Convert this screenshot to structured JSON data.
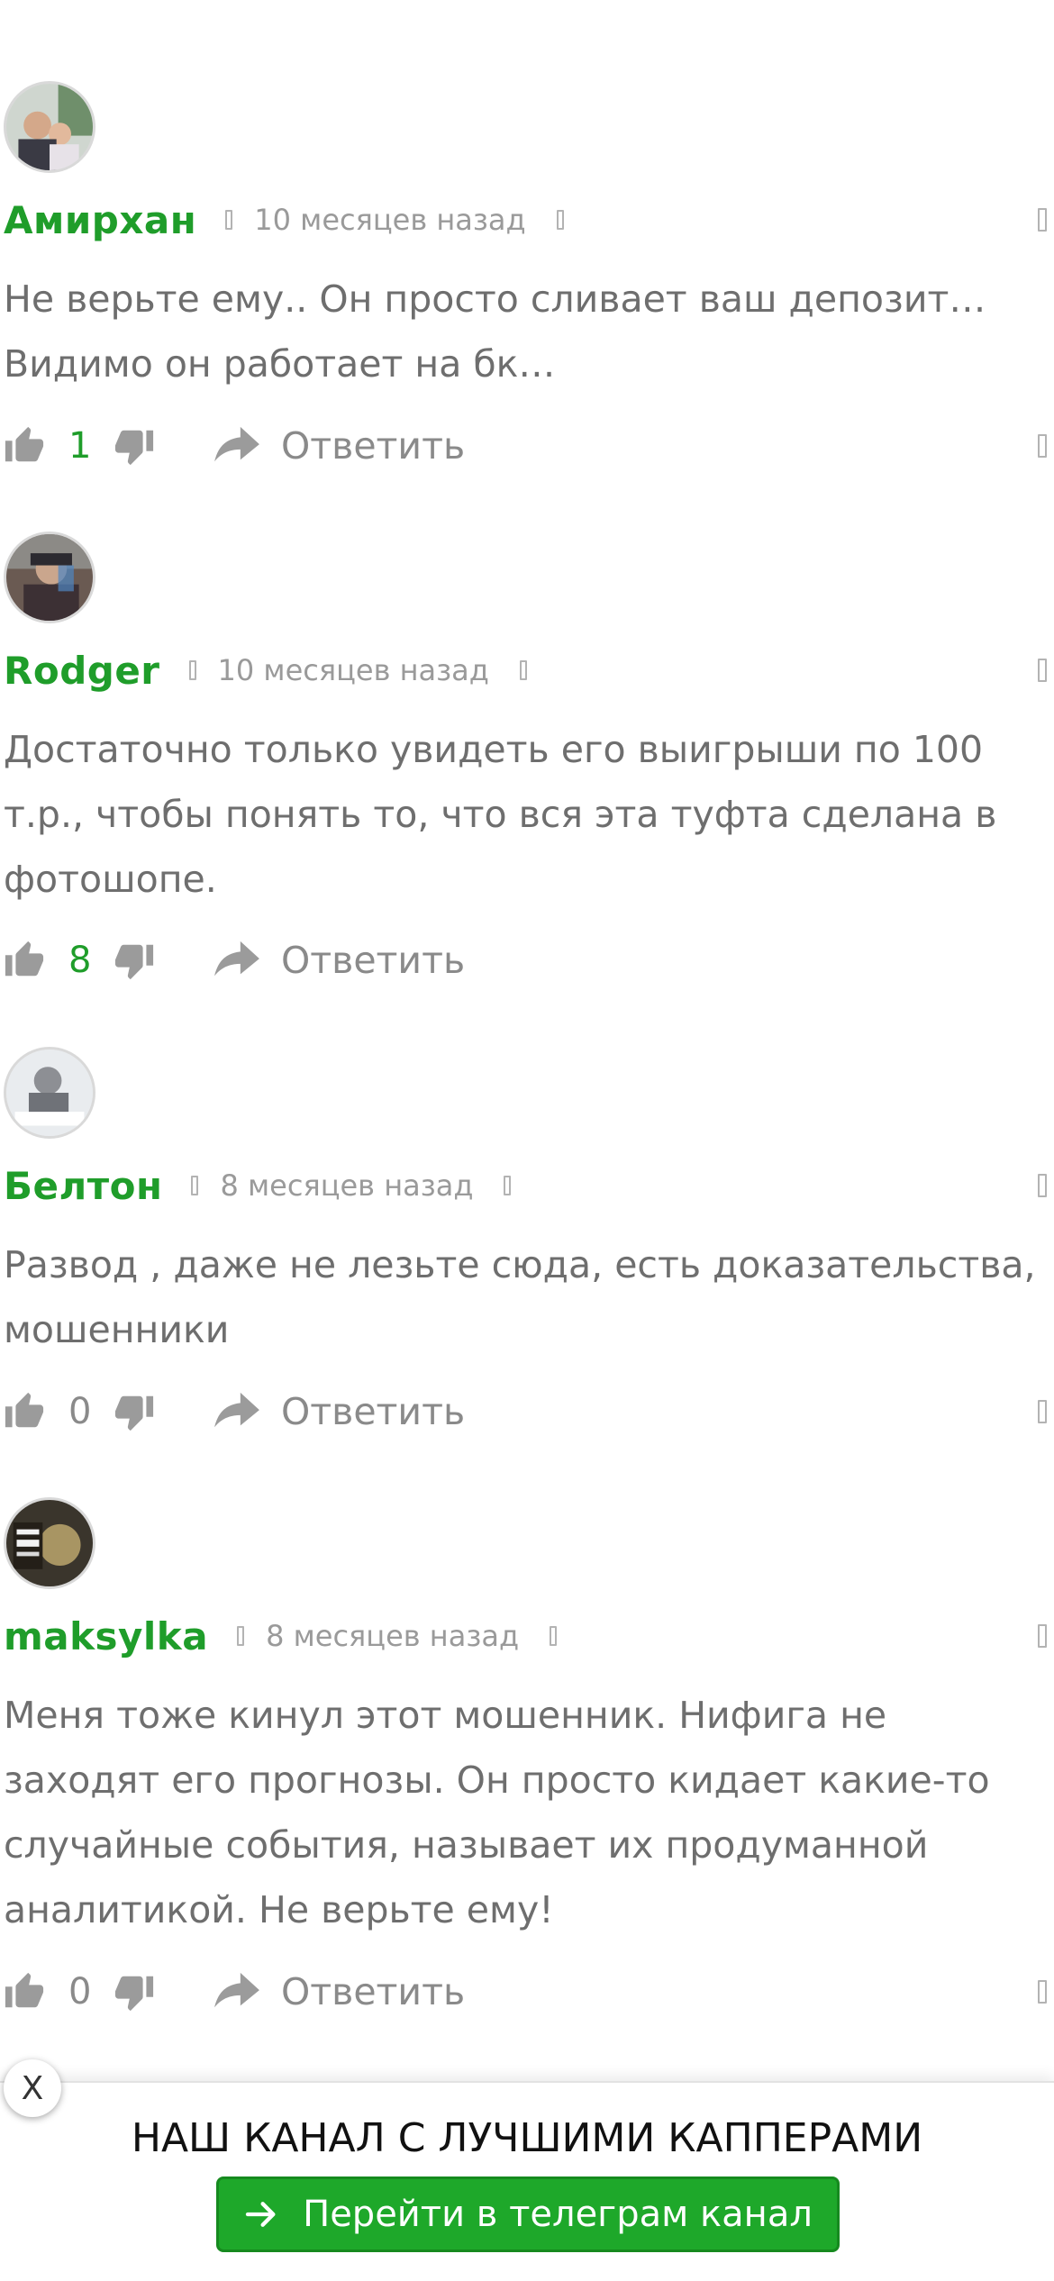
{
  "comments": [
    {
      "author": "Амирхан",
      "time": "10 месяцев назад",
      "text": "Не верьте ему.. Он просто сливает ваш депозит… Видимо он работает на бк…",
      "votes": "1",
      "reply_label": "Ответить",
      "avatar_icon": "user-photo-avatar"
    },
    {
      "author": "Rodger",
      "time": "10 месяцев назад",
      "text": "Достаточно только увидеть его выигрыши по 100 т.р., чтобы понять то, что вся эта туфта сделана в фотошопе.",
      "votes": "8",
      "reply_label": "Ответить",
      "avatar_icon": "user-photo-avatar"
    },
    {
      "author": "Белтон",
      "time": "8 месяцев назад",
      "text": "Развод , даже не лезьте сюда, есть доказательства, мошенники",
      "votes": "0",
      "reply_label": "Ответить",
      "avatar_icon": "user-photo-avatar"
    },
    {
      "author": "maksylka",
      "time": "8 месяцев назад",
      "text": "Меня тоже кинул этот мошенник. Нифига не заходят его прогнозы. Он просто кидает какие-то случайные события, называет их продуманной аналитикой. Не верьте ему!",
      "votes": "0",
      "reply_label": "Ответить",
      "avatar_icon": "user-photo-avatar"
    }
  ],
  "banner": {
    "close_label": "X",
    "title": "НАШ КАНАЛ С ЛУЧШИМИ КАППЕРАМИ",
    "button_label": "Перейти в телеграм канал",
    "button_icon": "arrow-right-icon"
  },
  "colors": {
    "author": "#1f9d2a",
    "vote_positive": "#1f9d2a",
    "text": "#6e6e6e",
    "muted": "#9a9a9a",
    "button_bg": "#1ea82a"
  }
}
